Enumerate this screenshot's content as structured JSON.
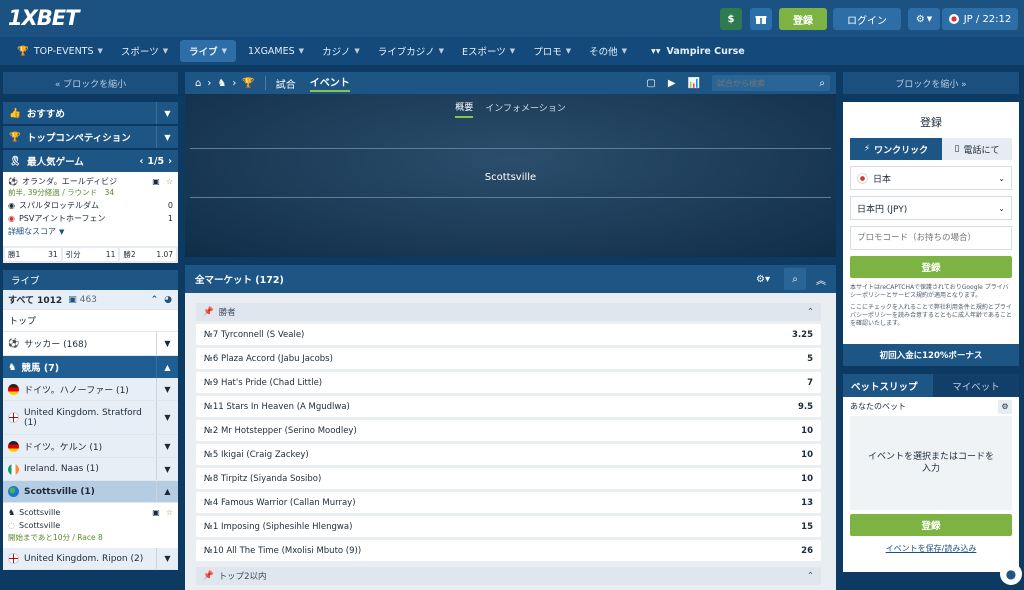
{
  "header": {
    "logo": "1XBET",
    "register_label": "登録",
    "login_label": "ログイン",
    "lang_time": "JP / 22:12"
  },
  "nav": [
    {
      "label": "TOP-EVENTS"
    },
    {
      "label": "スポーツ"
    },
    {
      "label": "ライブ"
    },
    {
      "label": "1XGAMES"
    },
    {
      "label": "カジノ"
    },
    {
      "label": "ライブカジノ"
    },
    {
      "label": "Eスポーツ"
    },
    {
      "label": "プロモ"
    },
    {
      "label": "その他"
    }
  ],
  "nav_promo": "Vampire Curse",
  "left": {
    "collapse": "« ブロックを縮小",
    "recommended": "おすすめ",
    "top_comp": "トップコンペティション",
    "popular": "最人気ゲーム",
    "popular_page": "1/5",
    "match": {
      "title": "オランダ。エールディビジ",
      "time": "前半, 39分経過 / ラウンド　34",
      "team1": "スパルタロッテルダム",
      "score1": "0",
      "team2": "PSVアイントホーフェン",
      "score2": "1",
      "details": "詳細なスコア"
    },
    "odds": [
      {
        "label": "勝1",
        "value": "31"
      },
      {
        "label": "引分",
        "value": "11"
      },
      {
        "label": "勝2",
        "value": "1.07"
      }
    ],
    "live": "ライブ",
    "all": "すべて 1012",
    "all_count": "463",
    "top": "トップ",
    "soccer": "サッカー (168)",
    "horse": "競馬 (7)",
    "items": [
      {
        "label": "ドイツ。ハノーファー (1)",
        "flag": "de"
      },
      {
        "label": "United Kingdom. Stratford (1)",
        "flag": "uk"
      },
      {
        "label": "ドイツ。ケルン (1)",
        "flag": "de"
      },
      {
        "label": "Ireland. Naas (1)",
        "flag": "ie"
      }
    ],
    "selected": "Scottsville (1)",
    "sub1": "Scottsville",
    "sub2": "Scottsville",
    "sub_time": "開始まであと10分 / Race 8",
    "ripon": "United Kingdom. Ripon (2)"
  },
  "center": {
    "tab_match": "試合",
    "tab_event": "イベント",
    "search_placeholder": "試合から検索",
    "sub_tab1": "概要",
    "sub_tab2": "インフォメーション",
    "event_title": "Scottsville",
    "markets_label": "全マーケット (172)",
    "group_winner": "勝者",
    "markets": [
      {
        "name": "№7 Tyrconnell (S Veale)",
        "odd": "3.25"
      },
      {
        "name": "№6 Plaza Accord (Jabu Jacobs)",
        "odd": "5"
      },
      {
        "name": "№9 Hat's Pride (Chad Little)",
        "odd": "7"
      },
      {
        "name": "№11 Stars In Heaven (A Mgudlwa)",
        "odd": "9.5"
      },
      {
        "name": "№2 Mr Hotstepper (Serino Moodley)",
        "odd": "10"
      },
      {
        "name": "№5 Ikigai (Craig Zackey)",
        "odd": "10"
      },
      {
        "name": "№8 Tirpitz (Siyanda Sosibo)",
        "odd": "10"
      },
      {
        "name": "№4 Famous Warrior (Callan Murray)",
        "odd": "13"
      },
      {
        "name": "№1 Imposing (Siphesihle Hlengwa)",
        "odd": "15"
      },
      {
        "name": "№10 All The Time (Mxolisi Mbuto (9))",
        "odd": "26"
      }
    ],
    "group_top2": "トップ2以内"
  },
  "right": {
    "collapse": "ブロックを縮小 »",
    "reg_title": "登録",
    "one_click": "ワンクリック",
    "by_phone": "電話にて",
    "country": "日本",
    "currency": "日本円 (JPY)",
    "promo_placeholder": "プロモコード（お持ちの場合）",
    "reg_button": "登録",
    "captcha_text": "本サイトはreCAPTCHAで保護されておりGoogle プライバシーポリシーとサービス規約が適用となります。",
    "terms_text": "ここにチェックを入れることで弊社利用条件と規約とプライバシーポリシーを読み合意するとともに成人年齢であることを確認いたします。",
    "bonus": "初回入金に120%ボーナス",
    "betslip": "ベットスリップ",
    "mybets": "マイベット",
    "your_bet": "あなたのベット",
    "empty_msg": "イベントを選択またはコードを入力",
    "slip_button": "登録",
    "save_load": "イベントを保存/読み込み"
  }
}
